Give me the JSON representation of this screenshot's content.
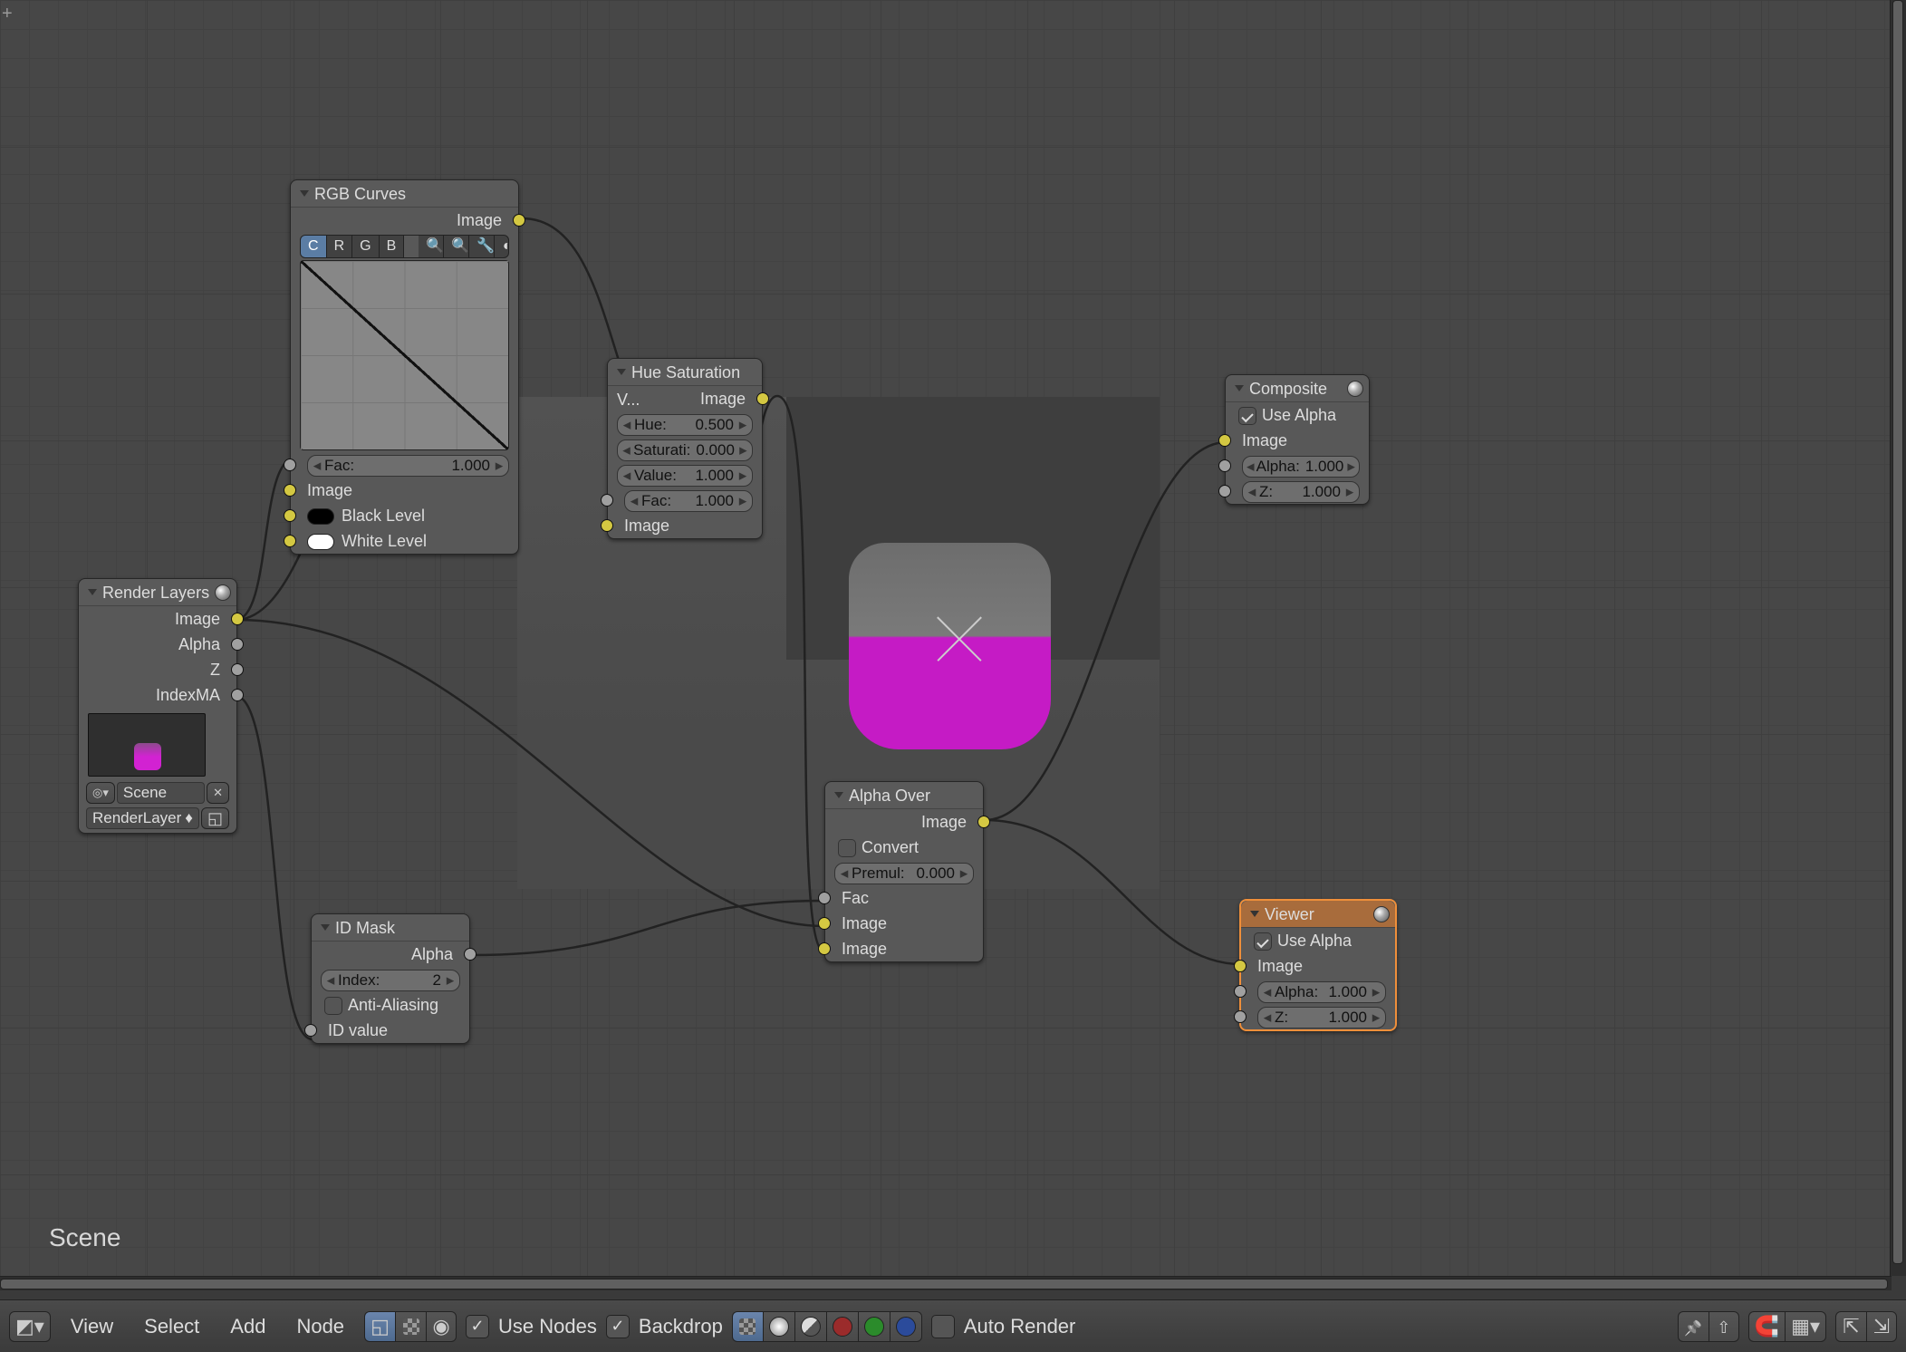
{
  "scene_label": "Scene",
  "nodes": {
    "render_layers": {
      "title": "Render Layers",
      "outputs": [
        "Image",
        "Alpha",
        "Z",
        "IndexMA"
      ],
      "scene_label": "Scene",
      "layer_label": "RenderLayer"
    },
    "rgb_curves": {
      "title": "RGB Curves",
      "output": "Image",
      "channels": [
        "C",
        "R",
        "G",
        "B"
      ],
      "fac_label": "Fac:",
      "fac_value": "1.000",
      "input_image": "Image",
      "black_level": "Black Level",
      "white_level": "White Level"
    },
    "hsv": {
      "title": "Hue Saturation V...",
      "output": "Image",
      "hue_label": "Hue:",
      "hue_value": "0.500",
      "sat_label": "Saturati:",
      "sat_value": "0.000",
      "val_label": "Value:",
      "val_value": "1.000",
      "fac_label": "Fac:",
      "fac_value": "1.000",
      "input_image": "Image"
    },
    "id_mask": {
      "title": "ID Mask",
      "output": "Alpha",
      "index_label": "Index:",
      "index_value": "2",
      "aa_label": "Anti-Aliasing",
      "input": "ID value"
    },
    "alpha_over": {
      "title": "Alpha Over",
      "output": "Image",
      "convert_label": "Convert Premul",
      "premul_label": "Premul:",
      "premul_value": "0.000",
      "in_fac": "Fac",
      "in_img1": "Image",
      "in_img2": "Image"
    },
    "composite": {
      "title": "Composite",
      "use_alpha": "Use Alpha",
      "input_image": "Image",
      "alpha_label": "Alpha:",
      "alpha_value": "1.000",
      "z_label": "Z:",
      "z_value": "1.000"
    },
    "viewer": {
      "title": "Viewer",
      "use_alpha": "Use Alpha",
      "input_image": "Image",
      "alpha_label": "Alpha:",
      "alpha_value": "1.000",
      "z_label": "Z:",
      "z_value": "1.000"
    }
  },
  "header": {
    "menus": [
      "View",
      "Select",
      "Add",
      "Node"
    ],
    "use_nodes": "Use Nodes",
    "backdrop": "Backdrop",
    "auto_render": "Auto Render"
  }
}
